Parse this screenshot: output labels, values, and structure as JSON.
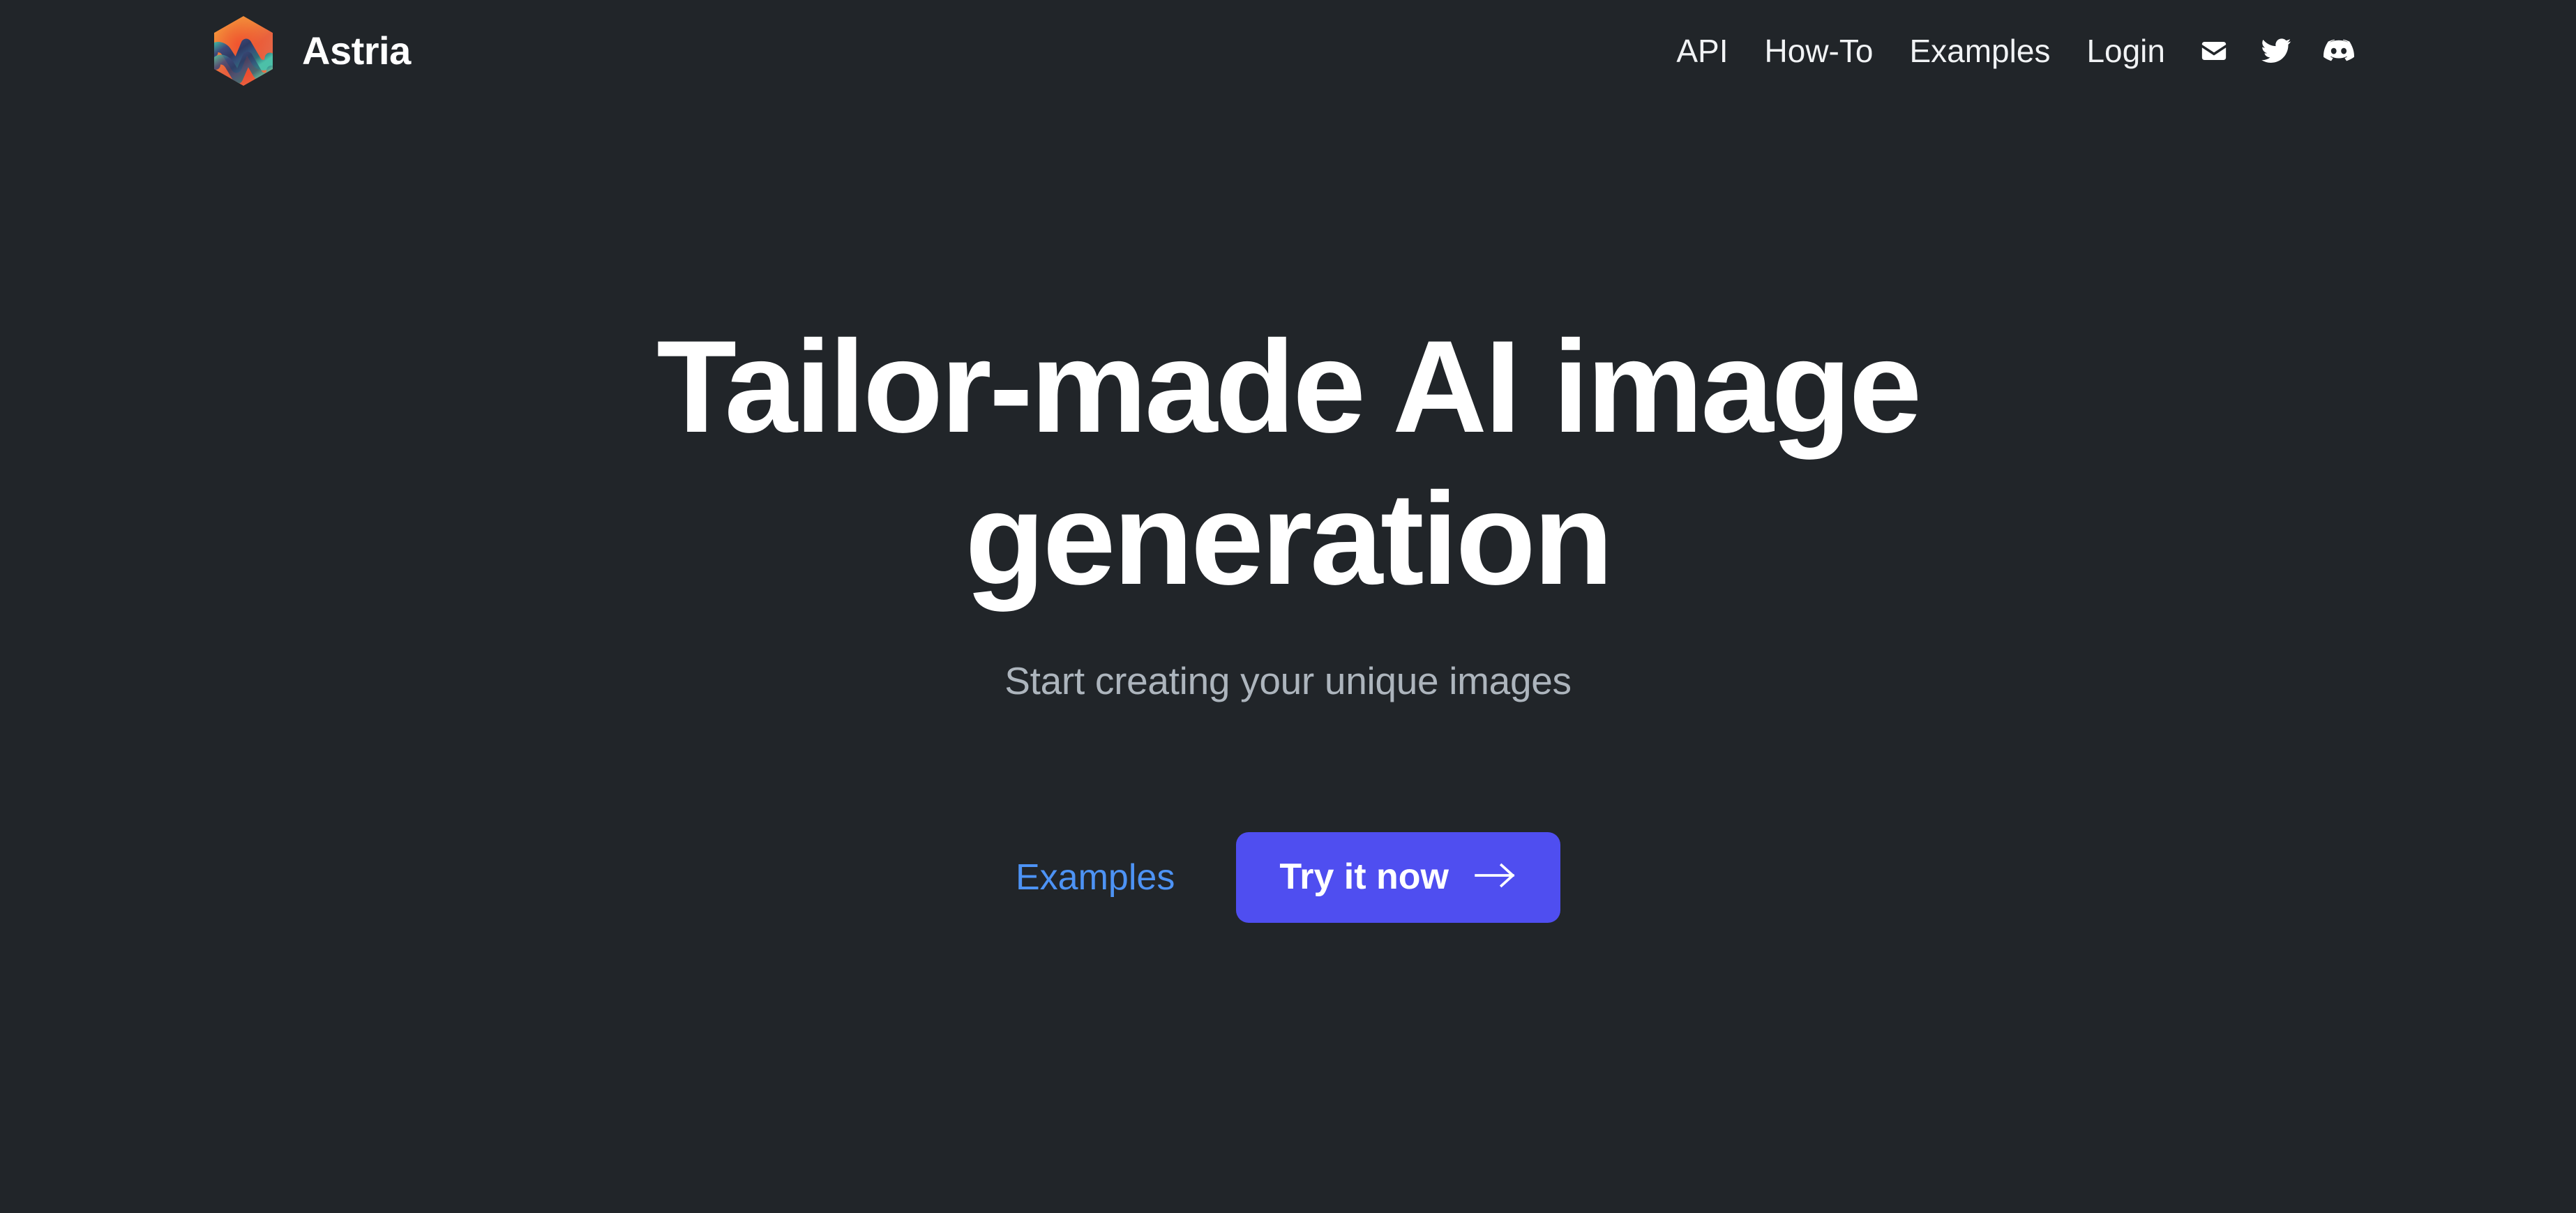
{
  "theme": {
    "background": "#212529",
    "text_primary": "#ffffff",
    "text_muted": "#adb5bd",
    "link_blue": "#4d93f5",
    "button_indigo": "#4f4ef0"
  },
  "header": {
    "brand_name": "Astria",
    "logo_icon": "astria-hexagon-logo",
    "nav_links": [
      {
        "label": "API"
      },
      {
        "label": "How-To"
      },
      {
        "label": "Examples"
      },
      {
        "label": "Login"
      }
    ],
    "social_links": [
      {
        "icon": "envelope-icon",
        "title": "Email"
      },
      {
        "icon": "twitter-icon",
        "title": "Twitter"
      },
      {
        "icon": "discord-icon",
        "title": "Discord"
      }
    ]
  },
  "hero": {
    "title_line_1": "Tailor-made AI image",
    "title_line_2": "generation",
    "subtitle": "Start creating your unique images",
    "examples_link_label": "Examples",
    "cta_label": "Try it now",
    "cta_icon": "arrow-right-icon"
  }
}
